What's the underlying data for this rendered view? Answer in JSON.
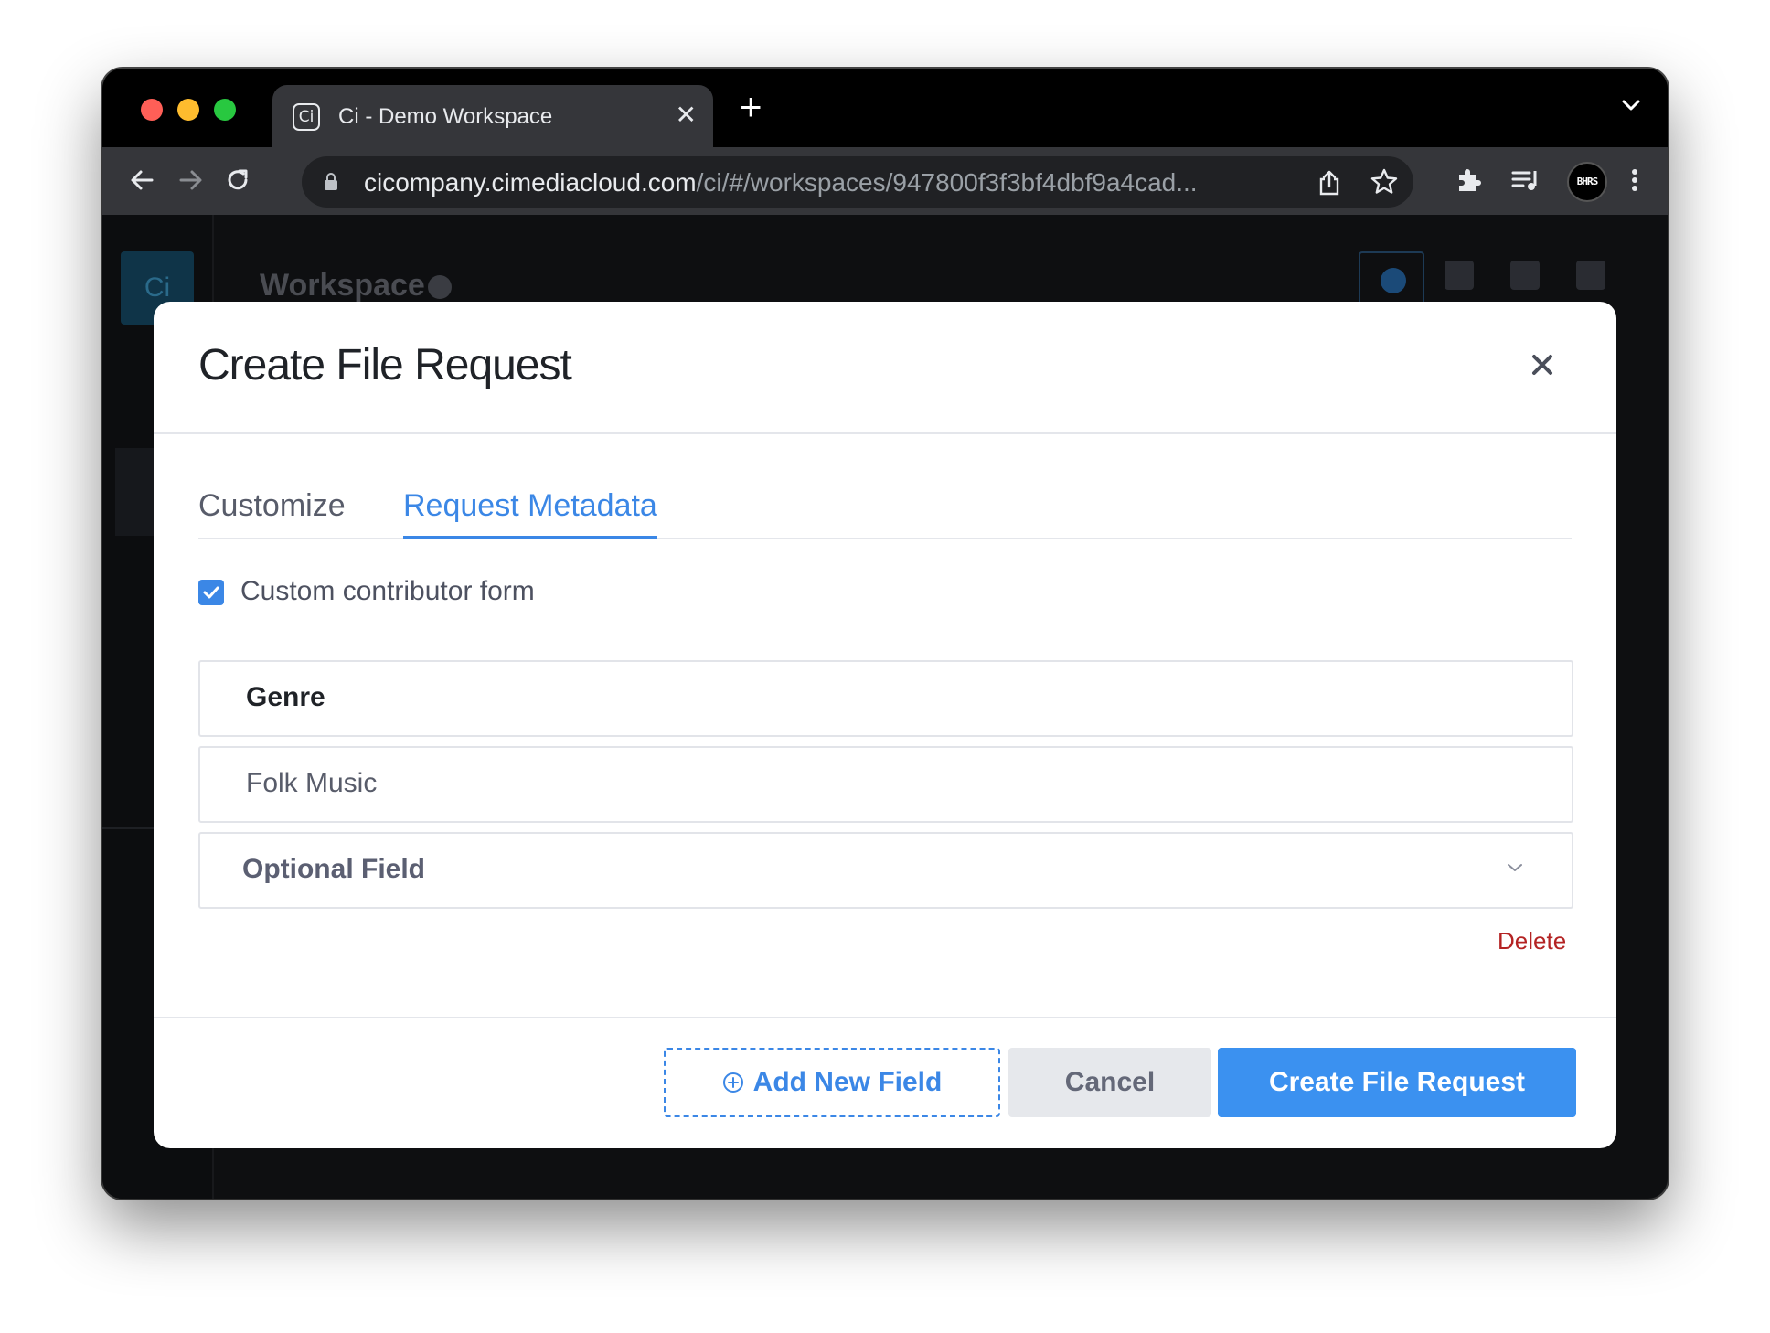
{
  "browser": {
    "tab_title": "Ci - Demo Workspace",
    "favicon_text": "Ci",
    "url_host": "cicompany.cimediacloud.com",
    "url_path": "/ci/#/workspaces/947800f3f3bf4dbf9a4cad...",
    "profile_badge": "BHRS"
  },
  "app": {
    "logo_text": "Ci",
    "title": "Workspace"
  },
  "modal": {
    "title": "Create File Request",
    "tabs": [
      {
        "label": "Customize",
        "active": false
      },
      {
        "label": "Request Metadata",
        "active": true
      }
    ],
    "custom_form": {
      "label": "Custom contributor form",
      "checked": true
    },
    "fields": {
      "field_name": "Genre",
      "field_value": "Folk Music",
      "field_type": "Optional Field"
    },
    "delete_label": "Delete",
    "buttons": {
      "add_field": "Add New Field",
      "cancel": "Cancel",
      "create": "Create File Request"
    }
  },
  "colors": {
    "accent": "#3b87e6",
    "primary_button": "#3b91f0",
    "danger": "#b42323"
  }
}
